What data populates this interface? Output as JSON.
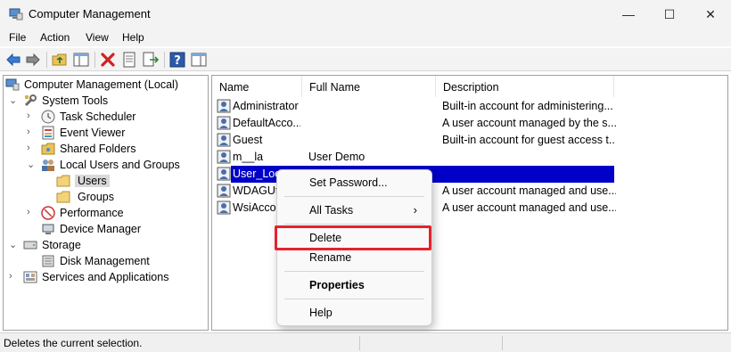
{
  "window": {
    "title": "Computer Management",
    "minimize": "—",
    "maximize": "☐",
    "close": "✕"
  },
  "menu": [
    "File",
    "Action",
    "View",
    "Help"
  ],
  "toolbar": [
    "back-arrow-icon",
    "forward-arrow-icon",
    "up-folder-icon",
    "show-hide-tree-icon",
    "delete-icon",
    "properties-icon",
    "export-list-icon",
    "help-icon",
    "action-pane-icon"
  ],
  "tree": [
    {
      "label": "Computer Management (Local)",
      "icon": "computer-management-icon"
    },
    {
      "label": "System Tools",
      "icon": "system-tools-icon"
    },
    {
      "label": "Task Scheduler",
      "icon": "clock-icon"
    },
    {
      "label": "Event Viewer",
      "icon": "event-viewer-icon"
    },
    {
      "label": "Shared Folders",
      "icon": "shared-folder-icon"
    },
    {
      "label": "Local Users and Groups",
      "icon": "users-group-icon"
    },
    {
      "label": "Users",
      "icon": "folder-icon"
    },
    {
      "label": "Groups",
      "icon": "folder-icon"
    },
    {
      "label": "Performance",
      "icon": "performance-icon"
    },
    {
      "label": "Device Manager",
      "icon": "device-manager-icon"
    },
    {
      "label": "Storage",
      "icon": "storage-icon"
    },
    {
      "label": "Disk Management",
      "icon": "disk-icon"
    },
    {
      "label": "Services and Applications",
      "icon": "services-icon"
    }
  ],
  "list": {
    "columns": [
      "Name",
      "Full Name",
      "Description"
    ],
    "rows": [
      {
        "name": "Administrator",
        "full_name": "",
        "description": "Built-in account for administering..."
      },
      {
        "name": "DefaultAcco...",
        "full_name": "",
        "description": "A user account managed by the s..."
      },
      {
        "name": "Guest",
        "full_name": "",
        "description": "Built-in account for guest access t..."
      },
      {
        "name": "m__la",
        "full_name": "User Demo",
        "description": ""
      },
      {
        "name": "User_Loc",
        "full_name": "",
        "description": ""
      },
      {
        "name": "WDAGUt",
        "full_name": "",
        "description": "A user account managed and use..."
      },
      {
        "name": "WsiAcco",
        "full_name": "",
        "description": "A user account managed and use..."
      }
    ]
  },
  "context_menu": {
    "items": [
      "Set Password...",
      "All Tasks",
      "Delete",
      "Rename",
      "Properties",
      "Help"
    ],
    "submenu_arrow": "›",
    "highlight_color": "#e5222e"
  },
  "status": {
    "text": "Deletes the current selection."
  },
  "colors": {
    "selection": "#0000c8",
    "highlight": "#e5222e"
  }
}
